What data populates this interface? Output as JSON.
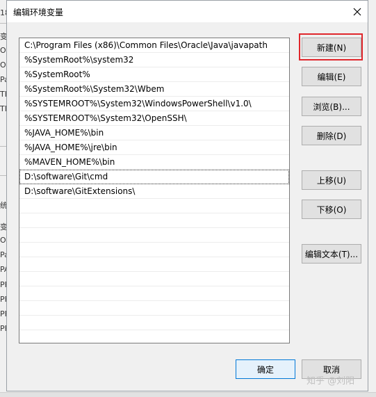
{
  "dialog": {
    "title": "编辑环境变量",
    "close_label": "×"
  },
  "paths": [
    "C:\\Program Files (x86)\\Common Files\\Oracle\\Java\\javapath",
    "%SystemRoot%\\system32",
    "%SystemRoot%",
    "%SystemRoot%\\System32\\Wbem",
    "%SYSTEMROOT%\\System32\\WindowsPowerShell\\v1.0\\",
    "%SYSTEMROOT%\\System32\\OpenSSH\\",
    "%JAVA_HOME%\\bin",
    "%JAVA_HOME%\\jre\\bin",
    "%MAVEN_HOME%\\bin",
    "D:\\software\\Git\\cmd",
    "D:\\software\\GitExtensions\\"
  ],
  "buttons": {
    "new": "新建(N)",
    "edit": "编辑(E)",
    "browse": "浏览(B)...",
    "delete": "删除(D)",
    "move_up": "上移(U)",
    "move_down": "下移(O)",
    "edit_text": "编辑文本(T)...",
    "ok": "确定",
    "cancel": "取消"
  },
  "background_fragments": [
    "18",
    "变",
    "O",
    "O",
    "Pa",
    "TE",
    "TM",
    "统",
    "变",
    "O",
    "Pa",
    "PA",
    "PF",
    "PF",
    "PF",
    "PF"
  ],
  "watermark": "知乎 @刘阳",
  "colors": {
    "highlight": "#e0262b",
    "primary_border": "#0078d7",
    "primary_fill": "#e5f1fb"
  }
}
